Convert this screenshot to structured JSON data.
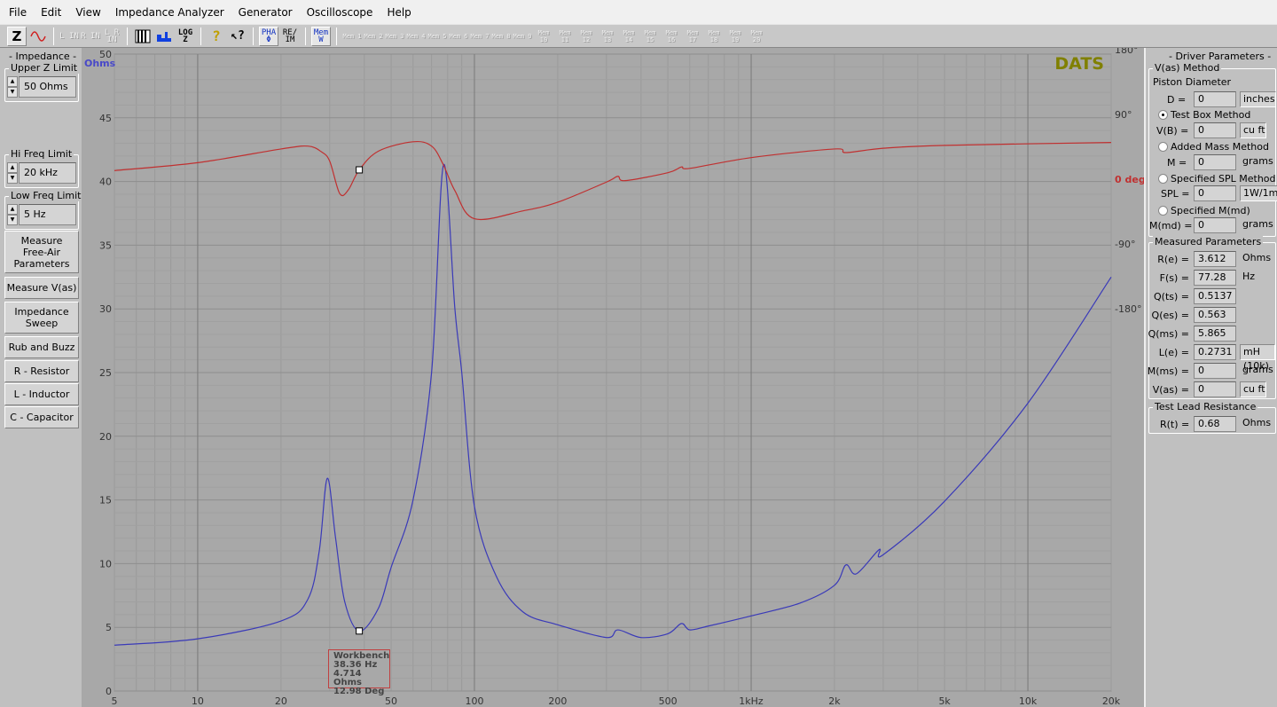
{
  "menu": [
    "File",
    "Edit",
    "View",
    "Impedance Analyzer",
    "Generator",
    "Oscilloscope",
    "Help"
  ],
  "toolbar": {
    "z": "Z",
    "lin": "L IN",
    "rin": "R IN",
    "lrin": "L R IN",
    "log": "LOG Z",
    "help": "?",
    "whatsthis": "↖?",
    "pha": "PHA Φ",
    "reim": "RE/ IM",
    "memw": "Mem W",
    "mems": [
      "Mem 1",
      "Mem 2",
      "Mem 3",
      "Mem 4",
      "Mem 5",
      "Mem 6",
      "Mem 7",
      "Mem 8",
      "Mem 9",
      "Mem 10",
      "Mem 11",
      "Mem 12",
      "Mem 13",
      "Mem 14",
      "Mem 15",
      "Mem 16",
      "Mem 17",
      "Mem 18",
      "Mem 19",
      "Mem 20"
    ]
  },
  "left": {
    "title": "- Impedance -",
    "upper_label": "Upper Z Limit",
    "upper_value": "50 Ohms",
    "hi_label": "Hi Freq Limit",
    "hi_value": "20 kHz",
    "low_label": "Low Freq Limit",
    "low_value": "5 Hz",
    "buttons": [
      "Measure Free-Air Parameters",
      "Measure V(as)",
      "Impedance Sweep",
      "Rub and Buzz",
      "R - Resistor",
      "L - Inductor",
      "C - Capacitor"
    ]
  },
  "right": {
    "title": "- Driver Parameters -",
    "vas_method": "V(as) Method",
    "piston": "Piston Diameter",
    "d_label": "D =",
    "d_value": "0",
    "d_unit": "inches",
    "testbox": "Test Box Method",
    "vb_label": "V(B) =",
    "vb_value": "0",
    "vb_unit": "cu ft",
    "addedmass": "Added Mass Method",
    "m_label": "M =",
    "m_value": "0",
    "m_unit": "grams",
    "spl_method": "Specified SPL Method",
    "spl_label": "SPL =",
    "spl_value": "0",
    "spl_unit": "1W/1m",
    "mmd_method": "Specified M(md)",
    "mmd_label": "M(md) =",
    "mmd_value": "0",
    "mmd_unit": "grams",
    "measured": "Measured Parameters",
    "params": [
      {
        "label": "R(e) =",
        "value": "3.612",
        "unit": "Ohms",
        "boxed": false
      },
      {
        "label": "F(s) =",
        "value": "77.28",
        "unit": "Hz",
        "boxed": false
      },
      {
        "label": "Q(ts) =",
        "value": "0.5137",
        "unit": "",
        "boxed": false
      },
      {
        "label": "Q(es) =",
        "value": "0.563",
        "unit": "",
        "boxed": false
      },
      {
        "label": "Q(ms) =",
        "value": "5.865",
        "unit": "",
        "boxed": false
      },
      {
        "label": "L(e) =",
        "value": "0.2731",
        "unit": "mH (10k)",
        "boxed": true
      },
      {
        "label": "M(ms) =",
        "value": "0",
        "unit": "grams",
        "boxed": false
      },
      {
        "label": "V(as) =",
        "value": "0",
        "unit": "cu ft",
        "boxed": true
      }
    ],
    "lead": "Test Lead Resistance",
    "rt_label": "R(t) =",
    "rt_value": "0.68",
    "rt_unit": "Ohms"
  },
  "readout": {
    "title": "Workbench",
    "freq": "38.36 Hz",
    "ohms": "4.714 Ohms",
    "deg": "12.98 Deg"
  },
  "chart_data": {
    "type": "line",
    "logo": "DATS",
    "xscale": "log",
    "xlim": [
      5,
      20000
    ],
    "ylim": [
      0,
      50
    ],
    "y2lim": [
      -180,
      180
    ],
    "ylabel": "Ohms",
    "y2label": "0 deg",
    "xticks": [
      {
        "v": 5,
        "l": "5"
      },
      {
        "v": 10,
        "l": "10"
      },
      {
        "v": 20,
        "l": "20"
      },
      {
        "v": 50,
        "l": "50"
      },
      {
        "v": 100,
        "l": "100"
      },
      {
        "v": 200,
        "l": "200"
      },
      {
        "v": 500,
        "l": "500"
      },
      {
        "v": 1000,
        "l": "1kHz"
      },
      {
        "v": 2000,
        "l": "2k"
      },
      {
        "v": 5000,
        "l": "5k"
      },
      {
        "v": 10000,
        "l": "10k"
      },
      {
        "v": 20000,
        "l": "20k"
      }
    ],
    "yticks": [
      "0",
      "5",
      "10",
      "15",
      "20",
      "25",
      "30",
      "35",
      "40",
      "45",
      "50"
    ],
    "y2ticks": [
      {
        "v": 180,
        "l": "180°"
      },
      {
        "v": 90,
        "l": "90°"
      },
      {
        "v": -90,
        "l": "-90°"
      },
      {
        "v": -180,
        "l": "-180°"
      }
    ],
    "grid": true,
    "colors": {
      "impedance": "#3a3ab8",
      "phase": "#c03030",
      "logo": "#808000"
    },
    "series": [
      {
        "key": "impedance",
        "points": [
          [
            5,
            3.6
          ],
          [
            10,
            4.1
          ],
          [
            20,
            5.5
          ],
          [
            25,
            7.2
          ],
          [
            27.5,
            11
          ],
          [
            29.4,
            16.7
          ],
          [
            31.5,
            12
          ],
          [
            34,
            7
          ],
          [
            38.36,
            4.71
          ],
          [
            45,
            6.5
          ],
          [
            50,
            9.7
          ],
          [
            60,
            15
          ],
          [
            70,
            25
          ],
          [
            77.3,
            41.3
          ],
          [
            85,
            30
          ],
          [
            90,
            25
          ],
          [
            100,
            14.5
          ],
          [
            120,
            9
          ],
          [
            150,
            6.2
          ],
          [
            200,
            5.2
          ],
          [
            300,
            4.2
          ],
          [
            330,
            4.8
          ],
          [
            400,
            4.2
          ],
          [
            500,
            4.5
          ],
          [
            560,
            5.3
          ],
          [
            600,
            4.8
          ],
          [
            700,
            5.1
          ],
          [
            1000,
            5.9
          ],
          [
            1500,
            6.9
          ],
          [
            2000,
            8.3
          ],
          [
            2200,
            9.9
          ],
          [
            2400,
            9.2
          ],
          [
            2900,
            11.1
          ],
          [
            3000,
            10.7
          ],
          [
            5000,
            14.9
          ],
          [
            10000,
            22.6
          ],
          [
            20000,
            32.5
          ]
        ]
      },
      {
        "key": "phase",
        "points": [
          [
            5,
            12
          ],
          [
            10,
            23
          ],
          [
            20,
            42
          ],
          [
            25,
            46
          ],
          [
            28,
            38
          ],
          [
            30,
            25
          ],
          [
            32.6,
            -20
          ],
          [
            35,
            -15
          ],
          [
            38.36,
            12.98
          ],
          [
            45,
            39
          ],
          [
            60,
            52
          ],
          [
            70,
            46
          ],
          [
            77,
            21
          ],
          [
            85,
            -16
          ],
          [
            100,
            -55
          ],
          [
            150,
            -44
          ],
          [
            200,
            -32
          ],
          [
            300,
            -4
          ],
          [
            330,
            4
          ],
          [
            350,
            -2
          ],
          [
            500,
            9
          ],
          [
            560,
            17
          ],
          [
            600,
            15
          ],
          [
            1000,
            30
          ],
          [
            2000,
            42
          ],
          [
            2200,
            37
          ],
          [
            3000,
            43
          ],
          [
            5000,
            47
          ],
          [
            20000,
            51
          ]
        ]
      }
    ],
    "marker": {
      "freq": 38.36,
      "ohms": 4.714,
      "deg": 12.98
    }
  }
}
